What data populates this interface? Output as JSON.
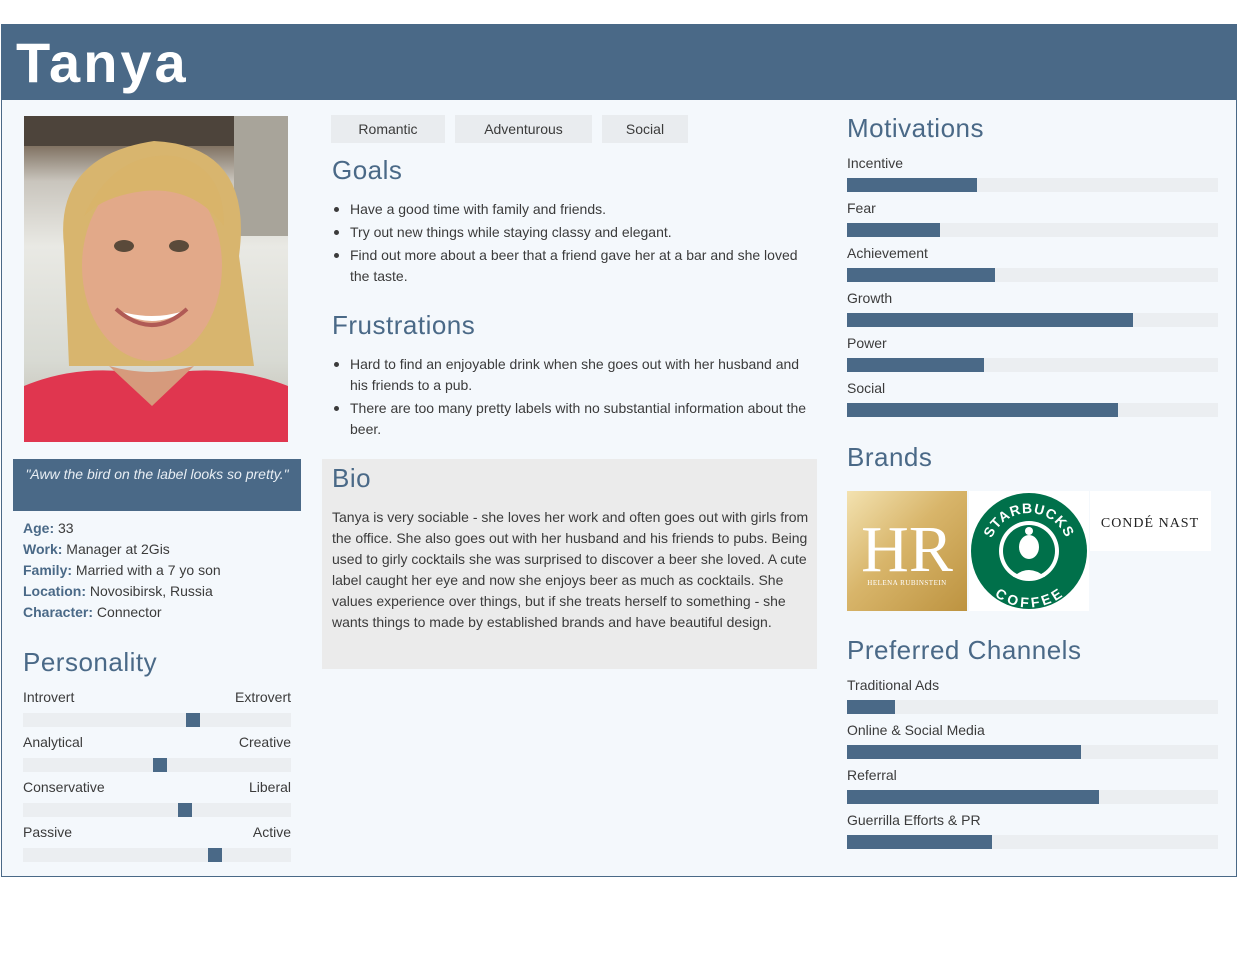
{
  "persona": {
    "name": "Tanya",
    "quote": "\"Aww the bird on the label looks so pretty.\"",
    "facts": [
      {
        "label": "Age:",
        "value": " 33"
      },
      {
        "label": "Work:",
        "value": " Manager at 2Gis"
      },
      {
        "label": "Family:",
        "value": " Married with a 7 yo son"
      },
      {
        "label": "Location:",
        "value": " Novosibirsk, Russia"
      },
      {
        "label": "Character:",
        "value": " Connector"
      }
    ]
  },
  "tags": [
    "Romantic",
    "Adventurous",
    "Social"
  ],
  "personality": {
    "title": "Personality",
    "scales": [
      {
        "left": "Introvert",
        "right": "Extrovert",
        "level": 0.64
      },
      {
        "left": "Analytical",
        "right": "Creative",
        "level": 0.51
      },
      {
        "left": "Conservative",
        "right": "Liberal",
        "level": 0.61
      },
      {
        "left": "Passive",
        "right": "Active",
        "level": 0.73
      }
    ]
  },
  "goals": {
    "title": "Goals",
    "items": [
      "Have a good time with family and friends.",
      "Try out new things while staying classy and elegant.",
      "Find out more about a beer that a friend gave her at a bar and she loved the taste."
    ]
  },
  "frustrations": {
    "title": "Frustrations",
    "items": [
      "Hard to find an enjoyable drink when she goes out with her husband and his friends to a pub.",
      "There are too many pretty labels with no substantial information about the beer."
    ]
  },
  "bio": {
    "title": "Bio",
    "text": "Tanya is very sociable - she loves her work and often goes out with girls from the office. She also goes out with her husband and his friends to pubs. Being used to girly cocktails she was surprised to discover a beer she loved. A cute label caught her eye and now she enjoys beer as much as cocktails. She values experience over things, but if she treats herself to something - she wants things to made by established brands and have beautiful design."
  },
  "motivations": {
    "title": "Motivations",
    "items": [
      {
        "label": "Incentive",
        "level": 0.35
      },
      {
        "label": "Fear",
        "level": 0.25
      },
      {
        "label": "Achievement",
        "level": 0.4
      },
      {
        "label": "Growth",
        "level": 0.77
      },
      {
        "label": "Power",
        "level": 0.37
      },
      {
        "label": "Social",
        "level": 0.73
      }
    ]
  },
  "brands": {
    "title": "Brands",
    "logos": [
      {
        "name": "helena-rubinstein",
        "mark": "HR",
        "text": "HELENA RUBINSTEIN"
      },
      {
        "name": "starbucks",
        "top": "STARBUCKS",
        "bottom": "COFFEE"
      },
      {
        "name": "conde-nast",
        "text": "CONDÉ NAST"
      }
    ]
  },
  "channels": {
    "title": "Preferred Channels",
    "items": [
      {
        "label": "Traditional Ads",
        "level": 0.13
      },
      {
        "label": "Online & Social Media",
        "level": 0.63
      },
      {
        "label": "Referral",
        "level": 0.68
      },
      {
        "label": "Guerrilla Efforts & PR",
        "level": 0.39
      }
    ]
  },
  "colors": {
    "accent": "#4a6987",
    "track": "#ebeef1",
    "card": "#f4f8fc"
  }
}
